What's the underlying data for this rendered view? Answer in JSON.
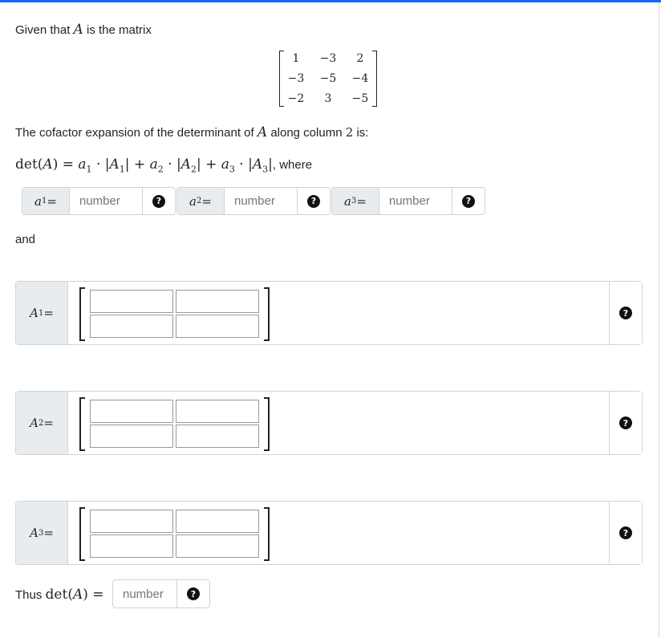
{
  "intro": {
    "prefix": "Given that",
    "var": "A",
    "suffix": "is the matrix"
  },
  "matrix": {
    "rows": [
      [
        "1",
        "−3",
        "2"
      ],
      [
        "−3",
        "−5",
        "−4"
      ],
      [
        "−2",
        "3",
        "−5"
      ]
    ]
  },
  "statement": {
    "prefix": "The cofactor expansion of the determinant of",
    "var": "A",
    "middle": "along column",
    "col": "2",
    "suffix": "is:"
  },
  "formula": {
    "det": "det",
    "open": "(",
    "A": "A",
    "close": ")",
    "eq": " = ",
    "a1": "a",
    "s1": "1",
    "dot": " · ",
    "bar": "|",
    "A1": "A",
    "plus": " + ",
    "where": ", where"
  },
  "inputs": [
    {
      "label_var": "a",
      "label_sub": "1",
      "label_eq": " =",
      "placeholder": "number"
    },
    {
      "label_var": "a",
      "label_sub": "2",
      "label_eq": " =",
      "placeholder": "number"
    },
    {
      "label_var": "a",
      "label_sub": "3",
      "label_eq": " =",
      "placeholder": "number"
    }
  ],
  "and_text": "and",
  "minors": [
    {
      "label_var": "A",
      "label_sub": "1",
      "label_eq": " ="
    },
    {
      "label_var": "A",
      "label_sub": "2",
      "label_eq": " ="
    },
    {
      "label_var": "A",
      "label_sub": "3",
      "label_eq": " ="
    }
  ],
  "final": {
    "prefix": "Thus",
    "det": "det",
    "A": "A",
    "eq": " =",
    "placeholder": "number"
  },
  "help_icon_glyph": "?",
  "accent_color": "#0d6efd"
}
